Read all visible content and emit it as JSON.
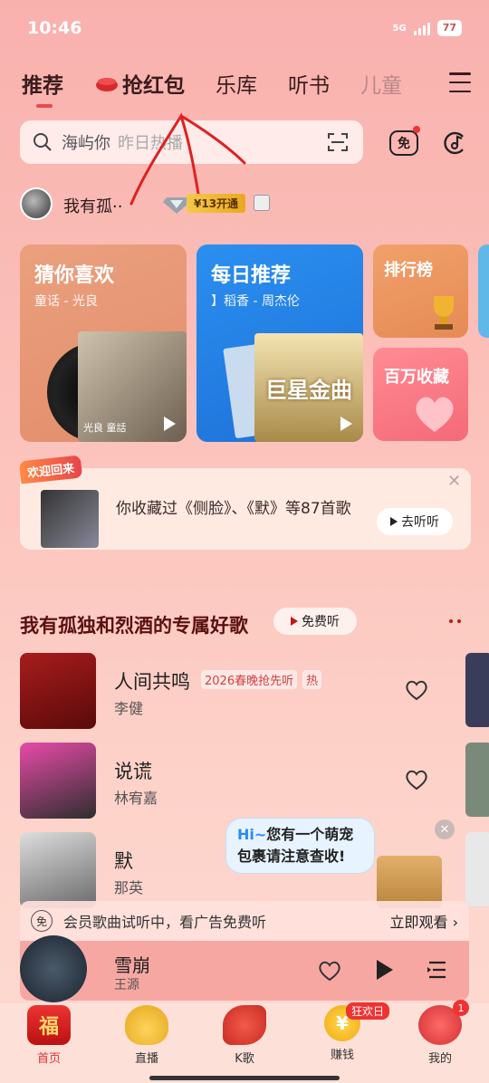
{
  "status": {
    "time": "10:46",
    "network": "5G",
    "battery": "77"
  },
  "nav": {
    "tabs": [
      {
        "label": "推荐",
        "active": true
      },
      {
        "label": "抢红包"
      },
      {
        "label": "乐库"
      },
      {
        "label": "听书"
      },
      {
        "label": "儿童"
      }
    ]
  },
  "search": {
    "value": "海屿你",
    "hint": "昨日热播"
  },
  "user": {
    "name": "我有孤··",
    "vip_badge": "¥13开通"
  },
  "cards": [
    {
      "title": "猜你喜欢",
      "subtitle": "童话 - 光良",
      "art_caption": "光良 童話"
    },
    {
      "title": "每日推荐",
      "subtitle": "】稻香 - 周杰伦",
      "art_caption": "巨星金曲"
    },
    {
      "title": "排行榜"
    },
    {
      "title": "百万收藏"
    }
  ],
  "welcome": {
    "tag": "欢迎回来",
    "text": "你收藏过《侧脸》、《默》等87首歌",
    "button": "去听听"
  },
  "section": {
    "title": "我有孤独和烈酒的专属好歌",
    "free_button": "免费听"
  },
  "songs": [
    {
      "title": "人间共鸣",
      "tag": "2026春晚抢先听",
      "tag2": "热",
      "artist": "李健"
    },
    {
      "title": "说谎",
      "artist": "林宥嘉"
    },
    {
      "title": "默",
      "artist": "那英"
    }
  ],
  "bubble": {
    "hi": "Hi~",
    "text": "您有一个萌宠包裹请注意查收!"
  },
  "adbar": {
    "icon": "免",
    "text": "会员歌曲试听中，看广告免费听",
    "link": "立即观看"
  },
  "player": {
    "title": "雪崩",
    "artist": "王源"
  },
  "bottom_nav": [
    {
      "label": "首页",
      "active": true
    },
    {
      "label": "直播"
    },
    {
      "label": "K歌"
    },
    {
      "label": "赚钱",
      "badge": "狂欢日"
    },
    {
      "label": "我的",
      "badge": "1"
    }
  ]
}
